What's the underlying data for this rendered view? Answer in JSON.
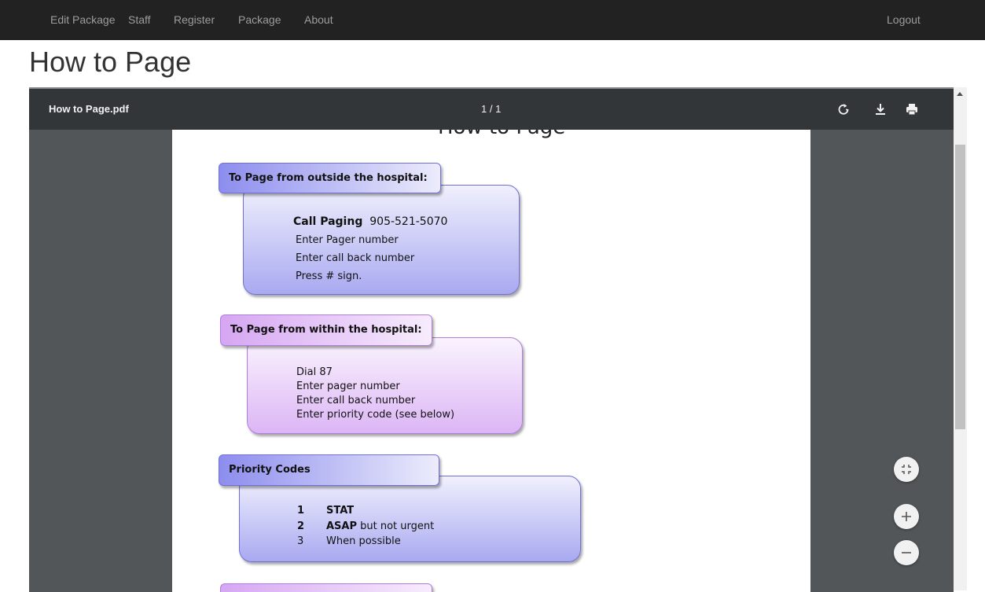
{
  "nav": {
    "items": [
      "Edit Package",
      "Staff",
      "Register",
      "Package",
      "About"
    ],
    "logout": "Logout"
  },
  "page": {
    "title": "How to Page"
  },
  "viewer": {
    "filename": "How to Page.pdf",
    "page_count": "1 / 1",
    "icons": [
      "rotate-icon",
      "download-icon",
      "print-icon",
      "fit-page-icon",
      "zoom-in-icon",
      "zoom-out-icon"
    ]
  },
  "document": {
    "heading": "How to Page",
    "sections": [
      {
        "title": "To Page from outside the hospital:",
        "call_label": "Call Paging",
        "call_number": "905-521-5070",
        "lines": [
          "Enter Pager number",
          "Enter call back number",
          "Press # sign."
        ]
      },
      {
        "title": "To Page from within the hospital:",
        "lines": [
          "Dial 87",
          "Enter pager number",
          "Enter call back number",
          "Enter priority code (see below)"
        ]
      },
      {
        "title": "Priority Codes",
        "codes": [
          {
            "num": "1",
            "label": "STAT",
            "rest": ""
          },
          {
            "num": "2",
            "label": "ASAP",
            "rest": " but not urgent"
          },
          {
            "num": "3",
            "label": "",
            "rest": "When possible"
          }
        ]
      }
    ]
  },
  "colors": {
    "navbar": "#222222",
    "toolbar": "#323639",
    "viewer_bg": "#525659",
    "blue_box": "#a9a9f1",
    "purple_box": "#dcb5f5"
  }
}
